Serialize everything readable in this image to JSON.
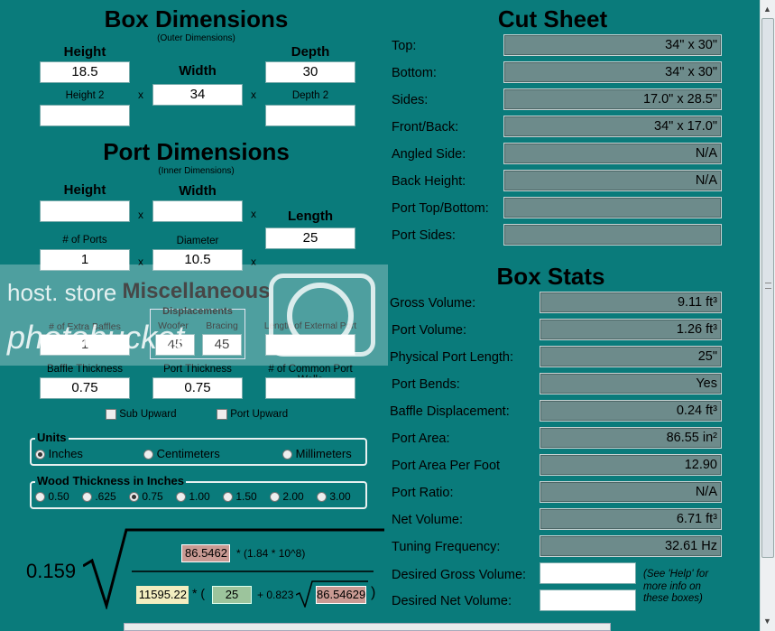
{
  "box": {
    "title": "Box Dimensions",
    "subtitle": "(Outer Dimensions)",
    "height_label": "Height",
    "width_label": "Width",
    "depth_label": "Depth",
    "height2_label": "Height 2",
    "depth2_label": "Depth 2",
    "height": "18.5",
    "width": "34",
    "depth": "30",
    "height2": "",
    "depth2": "",
    "x": "x"
  },
  "port": {
    "title": "Port Dimensions",
    "subtitle": "(Inner Dimensions)",
    "height_label": "Height",
    "width_label": "Width",
    "length_label": "Length",
    "ports_label": "# of Ports",
    "diameter_label": "Diameter",
    "height": "",
    "width": "",
    "length": "25",
    "ports": "1",
    "diameter": "10.5"
  },
  "misc": {
    "title": "Miscellaneous",
    "extra_baffles_label": "# of Extra Baffles",
    "displacements_label": "Displacements",
    "woofer_label": "Woofer",
    "bracing_label": "Bracing",
    "ext_port_label": "Length of External Port",
    "extra_baffles": "1",
    "woofer": "45",
    "bracing": "45",
    "ext_port": "",
    "baffle_thickness_label": "Baffle Thickness",
    "port_thickness_label": "Port Thickness",
    "common_walls_label": "# of Common Port Walls",
    "baffle_thickness": "0.75",
    "port_thickness": "0.75",
    "common_walls": "",
    "sub_upward": "Sub Upward",
    "port_upward": "Port Upward"
  },
  "units": {
    "title": "Units",
    "options": [
      "Inches",
      "Centimeters",
      "Millimeters"
    ],
    "selected": "Inches"
  },
  "wood": {
    "title": "Wood Thickness in Inches",
    "options": [
      "0.50",
      ".625",
      "0.75",
      "1.00",
      "1.50",
      "2.00",
      "3.00"
    ],
    "selected": "0.75"
  },
  "formula": {
    "coef": "0.159",
    "area1": "86.5462",
    "mult": "* (1.84 * 10^8)",
    "net": "11595.22",
    "star_paren": "* (",
    "length": "25",
    "plus": "+ 0.823",
    "area2": "86.54629",
    "close": ")"
  },
  "cut": {
    "title": "Cut Sheet",
    "rows": [
      {
        "label": "Top:",
        "value": "34\" x 30\""
      },
      {
        "label": "Bottom:",
        "value": "34\" x 30\""
      },
      {
        "label": "Sides:",
        "value": "17.0\" x 28.5\""
      },
      {
        "label": "Front/Back:",
        "value": "34\" x 17.0\""
      },
      {
        "label": "Angled Side:",
        "value": "N/A"
      },
      {
        "label": "Back Height:",
        "value": "N/A"
      },
      {
        "label": "Port Top/Bottom:",
        "value": ""
      },
      {
        "label": "Port Sides:",
        "value": ""
      }
    ]
  },
  "stats": {
    "title": "Box Stats",
    "rows": [
      {
        "label": "Gross Volume:",
        "value": "9.11 ft³"
      },
      {
        "label": "Port Volume:",
        "value": "1.26 ft³"
      },
      {
        "label": "Physical Port Length:",
        "value": "25\""
      },
      {
        "label": "Port Bends:",
        "value": "Yes"
      },
      {
        "label": "Baffle Displacement:",
        "value": "0.24 ft³"
      },
      {
        "label": "Port Area:",
        "value": "86.55 in²"
      },
      {
        "label": "Port Area Per Foot",
        "value": "12.90"
      },
      {
        "label": "Port Ratio:",
        "value": "N/A"
      },
      {
        "label": "Net Volume:",
        "value": "6.71 ft³"
      },
      {
        "label": "Tuning Frequency:",
        "value": "32.61 Hz"
      }
    ],
    "desired_gross_label": "Desired Gross Volume:",
    "desired_net_label": "Desired Net Volume:",
    "desired_gross": "",
    "desired_net": "",
    "help_note": "(See 'Help' for more info on these boxes)"
  },
  "watermark": {
    "line1": "host. store",
    "line2": "photobucket"
  },
  "colors": {
    "background": "#0a7b7b",
    "readonly_field": "#6d8b8b",
    "formula_pink": "#c99a93",
    "formula_yellow": "#f3eec0",
    "formula_green": "#9cc49c"
  }
}
